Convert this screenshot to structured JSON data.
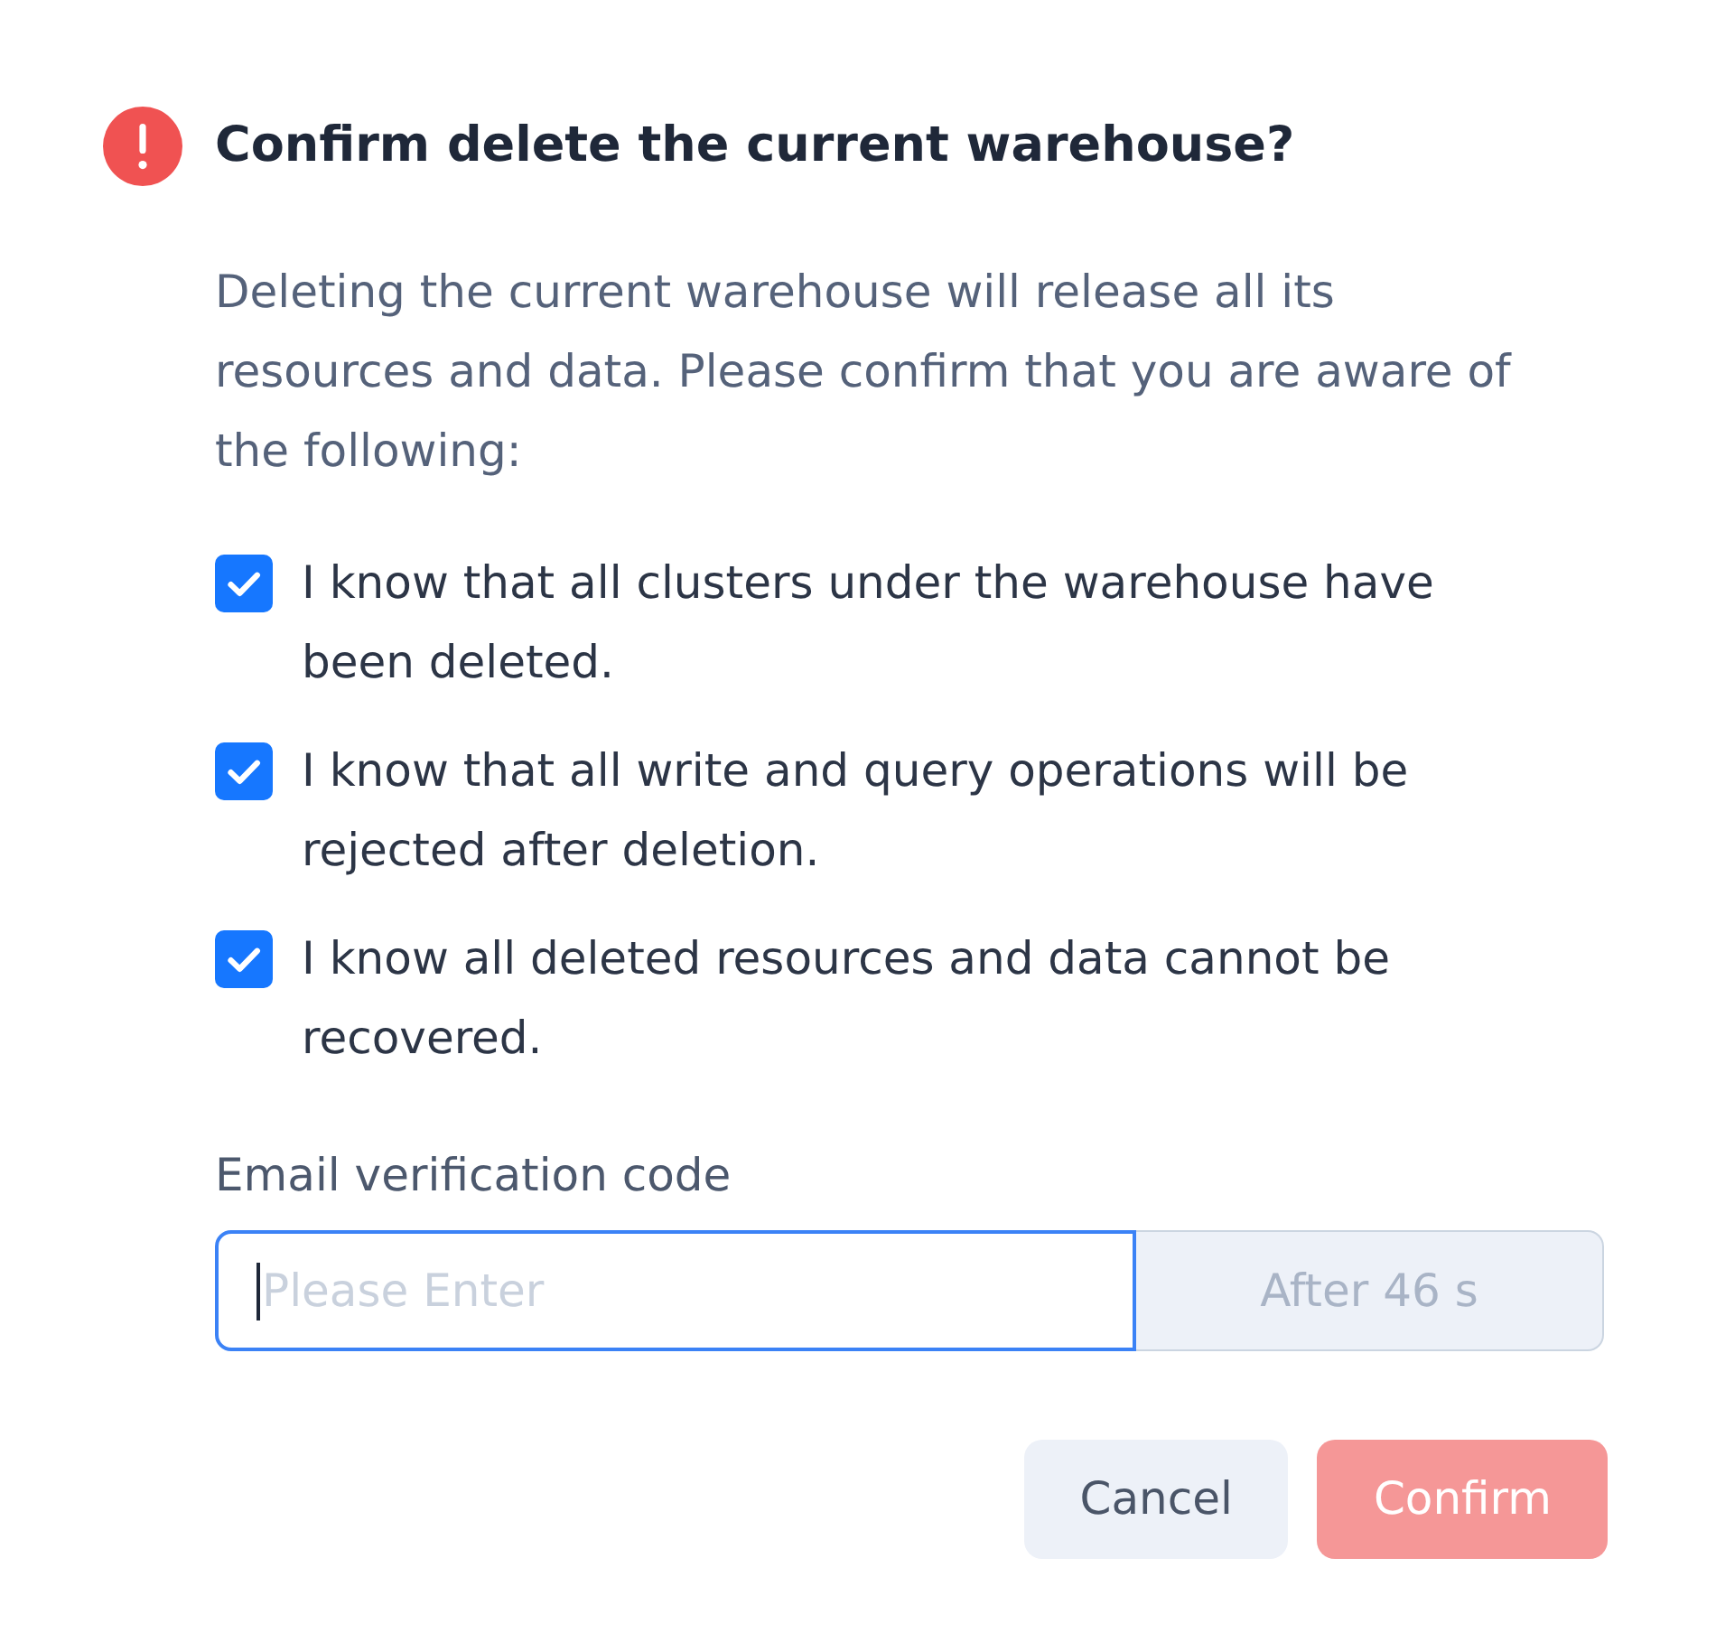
{
  "dialog": {
    "title": "Confirm delete the current warehouse?",
    "description": "Deleting the current warehouse will release all its resources and data. Please confirm that you are aware of the following:",
    "acknowledgements": [
      {
        "label": "I know that all clusters under the warehouse have been deleted.",
        "checked": true
      },
      {
        "label": "I know that all write and query operations will be rejected after deletion.",
        "checked": true
      },
      {
        "label": "I know all deleted resources and data cannot be recovered.",
        "checked": true
      }
    ],
    "verification": {
      "label": "Email verification code",
      "placeholder": "Please Enter",
      "focused": true,
      "code_button": {
        "label": "After 46 s",
        "disabled": true
      }
    },
    "buttons": [
      {
        "label": "Cancel",
        "kind": "secondary",
        "disabled": false
      },
      {
        "label": "Confirm",
        "kind": "danger",
        "disabled": true
      }
    ]
  }
}
